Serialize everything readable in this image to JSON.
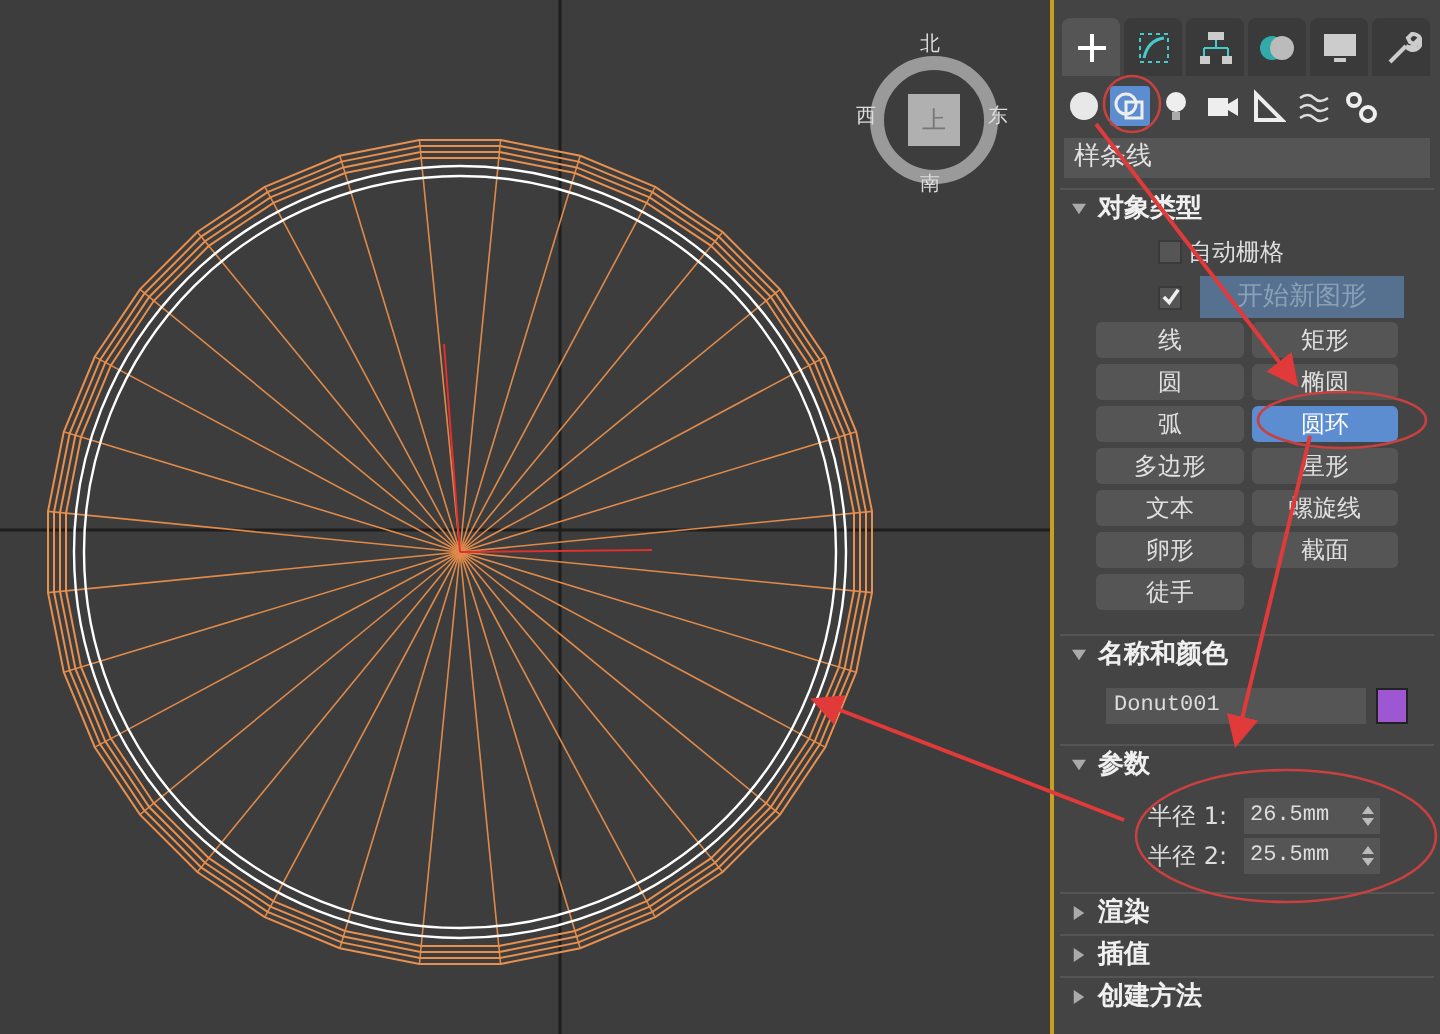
{
  "viewport": {
    "viewcube": {
      "top": "北",
      "left": "西",
      "right": "东",
      "bottom": "南",
      "face": "上"
    }
  },
  "command_panel": {
    "tabs": [
      {
        "kind": "plus",
        "selected": true
      },
      {
        "kind": "modify",
        "selected": false
      },
      {
        "kind": "hierarchy",
        "selected": false
      },
      {
        "kind": "motion",
        "selected": false
      },
      {
        "kind": "display",
        "selected": false
      },
      {
        "kind": "utilities",
        "selected": false
      }
    ],
    "subtabs": [
      {
        "kind": "sphere",
        "selected": false
      },
      {
        "kind": "shapes",
        "selected": true
      },
      {
        "kind": "light",
        "selected": false
      },
      {
        "kind": "camera",
        "selected": false
      },
      {
        "kind": "helper",
        "selected": false
      },
      {
        "kind": "waves",
        "selected": false
      },
      {
        "kind": "gears",
        "selected": false
      }
    ],
    "category": "样条线",
    "object_type": {
      "title": "对象类型",
      "expanded": true,
      "autogrid": {
        "label": "自动栅格",
        "checked": false
      },
      "start_new_shape": {
        "label": "开始新图形",
        "checked": true
      },
      "buttons": [
        {
          "label": "线",
          "selected": false
        },
        {
          "label": "矩形",
          "selected": false
        },
        {
          "label": "圆",
          "selected": false
        },
        {
          "label": "椭圆",
          "selected": false
        },
        {
          "label": "弧",
          "selected": false
        },
        {
          "label": "圆环",
          "selected": true
        },
        {
          "label": "多边形",
          "selected": false
        },
        {
          "label": "星形",
          "selected": false
        },
        {
          "label": "文本",
          "selected": false
        },
        {
          "label": "螺旋线",
          "selected": false
        },
        {
          "label": "卵形",
          "selected": false
        },
        {
          "label": "截面",
          "selected": false
        },
        {
          "label": "徒手",
          "selected": false
        }
      ]
    },
    "name_and_color": {
      "title": "名称和颜色",
      "expanded": true,
      "name": "Donut001",
      "color": "#9d57d3"
    },
    "parameters": {
      "title": "参数",
      "expanded": true,
      "fields": [
        {
          "label": "半径 1:",
          "value": "26.5mm"
        },
        {
          "label": "半径 2:",
          "value": "25.5mm"
        }
      ]
    },
    "collapsed_rollouts": [
      {
        "title": "渲染",
        "expanded": false
      },
      {
        "title": "插值",
        "expanded": false
      },
      {
        "title": "创建方法",
        "expanded": false
      }
    ]
  }
}
